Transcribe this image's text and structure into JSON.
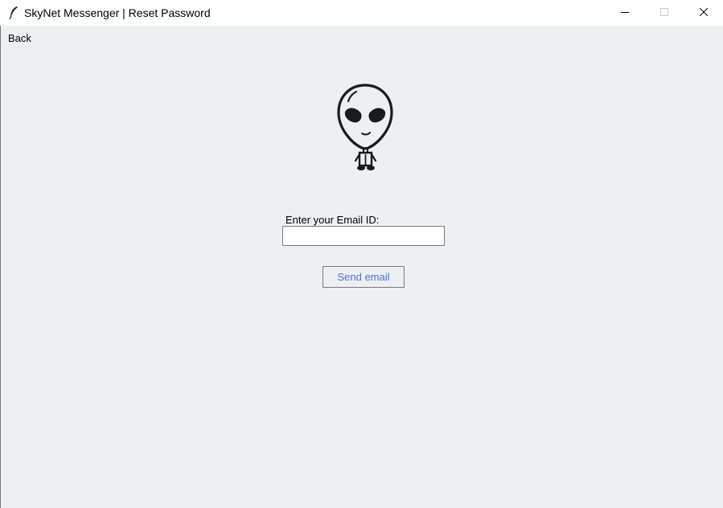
{
  "window": {
    "title": "SkyNet Messenger | Reset Password",
    "app_icon": "feather-icon",
    "controls": [
      "minimize-icon",
      "maximize-icon",
      "close-icon"
    ]
  },
  "nav": {
    "back_label": "Back"
  },
  "logo": {
    "icon": "alien-icon"
  },
  "form": {
    "email_label": "Enter your Email ID:",
    "email_value": "",
    "send_button_label": "Send email"
  },
  "colors": {
    "background": "#ecf0f3",
    "button_text": "#4a6fd0"
  }
}
